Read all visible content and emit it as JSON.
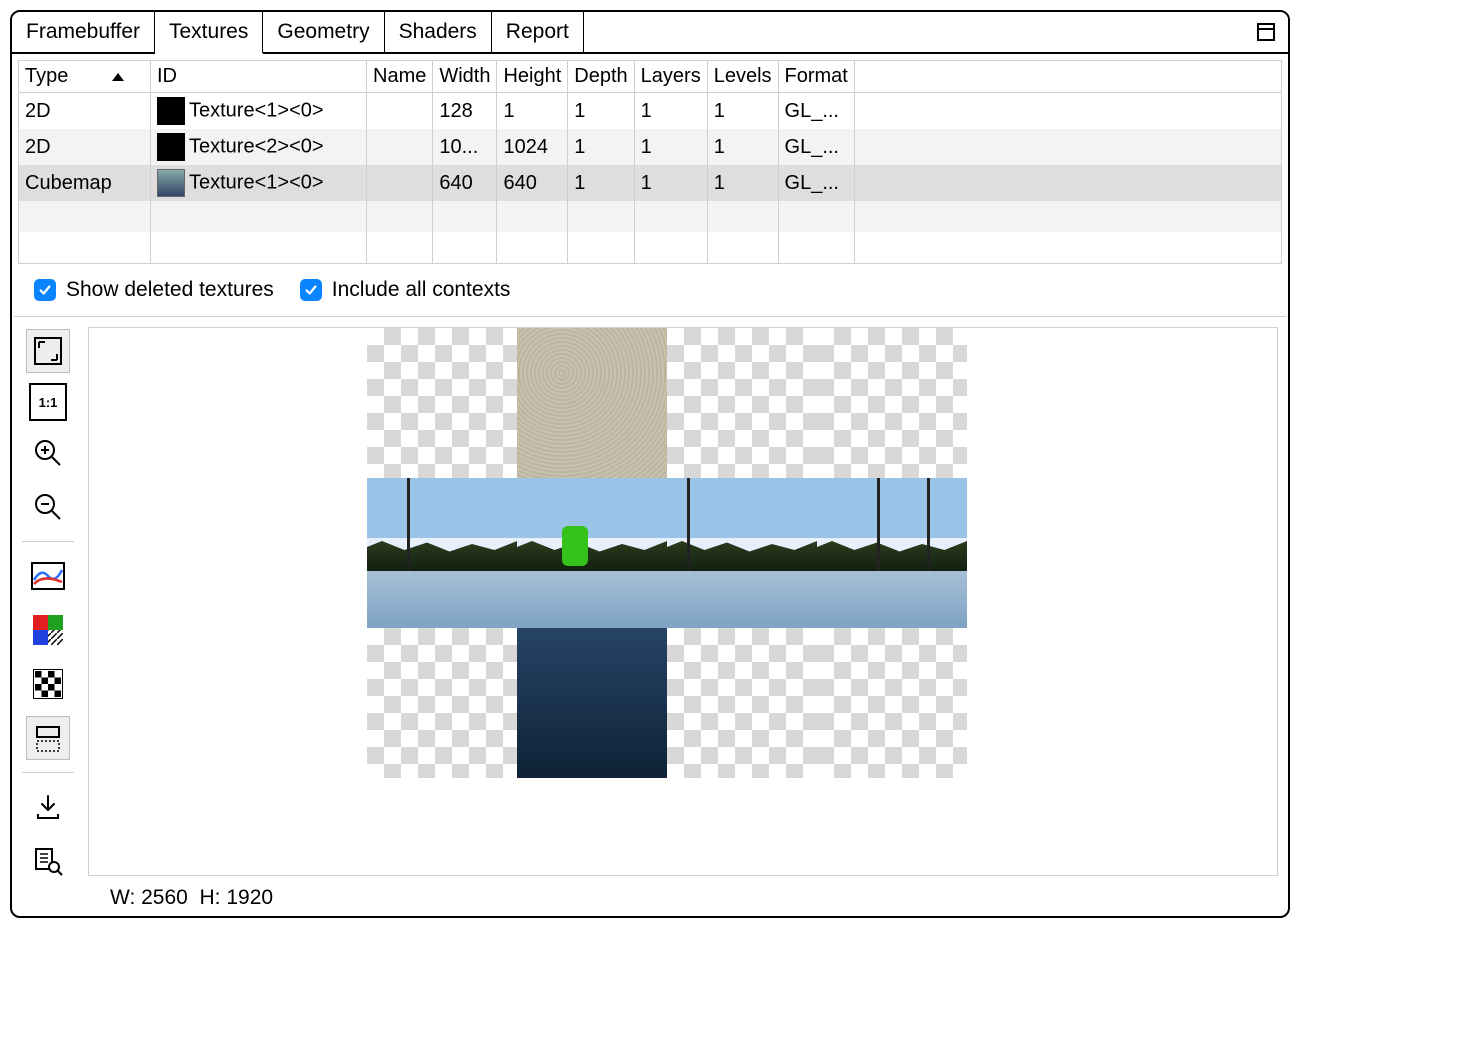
{
  "tabs": {
    "items": [
      {
        "label": "Framebuffer"
      },
      {
        "label": "Textures"
      },
      {
        "label": "Geometry"
      },
      {
        "label": "Shaders"
      },
      {
        "label": "Report"
      }
    ],
    "active_index": 1
  },
  "table": {
    "headers": [
      "Type",
      "ID",
      "Name",
      "Width",
      "Height",
      "Depth",
      "Layers",
      "Levels",
      "Format"
    ],
    "rows": [
      {
        "type": "2D",
        "id": "Texture<1><0>",
        "name": "",
        "width": "128",
        "height": "1",
        "depth": "1",
        "layers": "1",
        "levels": "1",
        "format": "GL_...",
        "thumb": "black"
      },
      {
        "type": "2D",
        "id": "Texture<2><0>",
        "name": "",
        "width": "10...",
        "height": "1024",
        "depth": "1",
        "layers": "1",
        "levels": "1",
        "format": "GL_...",
        "thumb": "black"
      },
      {
        "type": "Cubemap",
        "id": "Texture<1><0>",
        "name": "",
        "width": "640",
        "height": "640",
        "depth": "1",
        "layers": "1",
        "levels": "1",
        "format": "GL_...",
        "thumb": "cube"
      }
    ],
    "selected_row": 2,
    "empty_rows": 2
  },
  "checkboxes": {
    "show_deleted": {
      "label": "Show deleted textures",
      "checked": true
    },
    "include_all": {
      "label": "Include all contexts",
      "checked": true
    }
  },
  "viewer": {
    "status_w_label": "W:",
    "status_h_label": "H:",
    "status_w": "2560",
    "status_h": "1920"
  },
  "toolbar": {
    "items": [
      {
        "name": "zoom-fit",
        "active": true
      },
      {
        "name": "zoom-1to1",
        "label": "1:1"
      },
      {
        "name": "zoom-in"
      },
      {
        "name": "zoom-out"
      },
      {
        "sep": true
      },
      {
        "name": "histogram"
      },
      {
        "name": "channels"
      },
      {
        "name": "background-checker"
      },
      {
        "name": "flip-vertical",
        "active": true
      },
      {
        "sep": true
      },
      {
        "name": "export"
      },
      {
        "name": "inspect"
      }
    ]
  }
}
